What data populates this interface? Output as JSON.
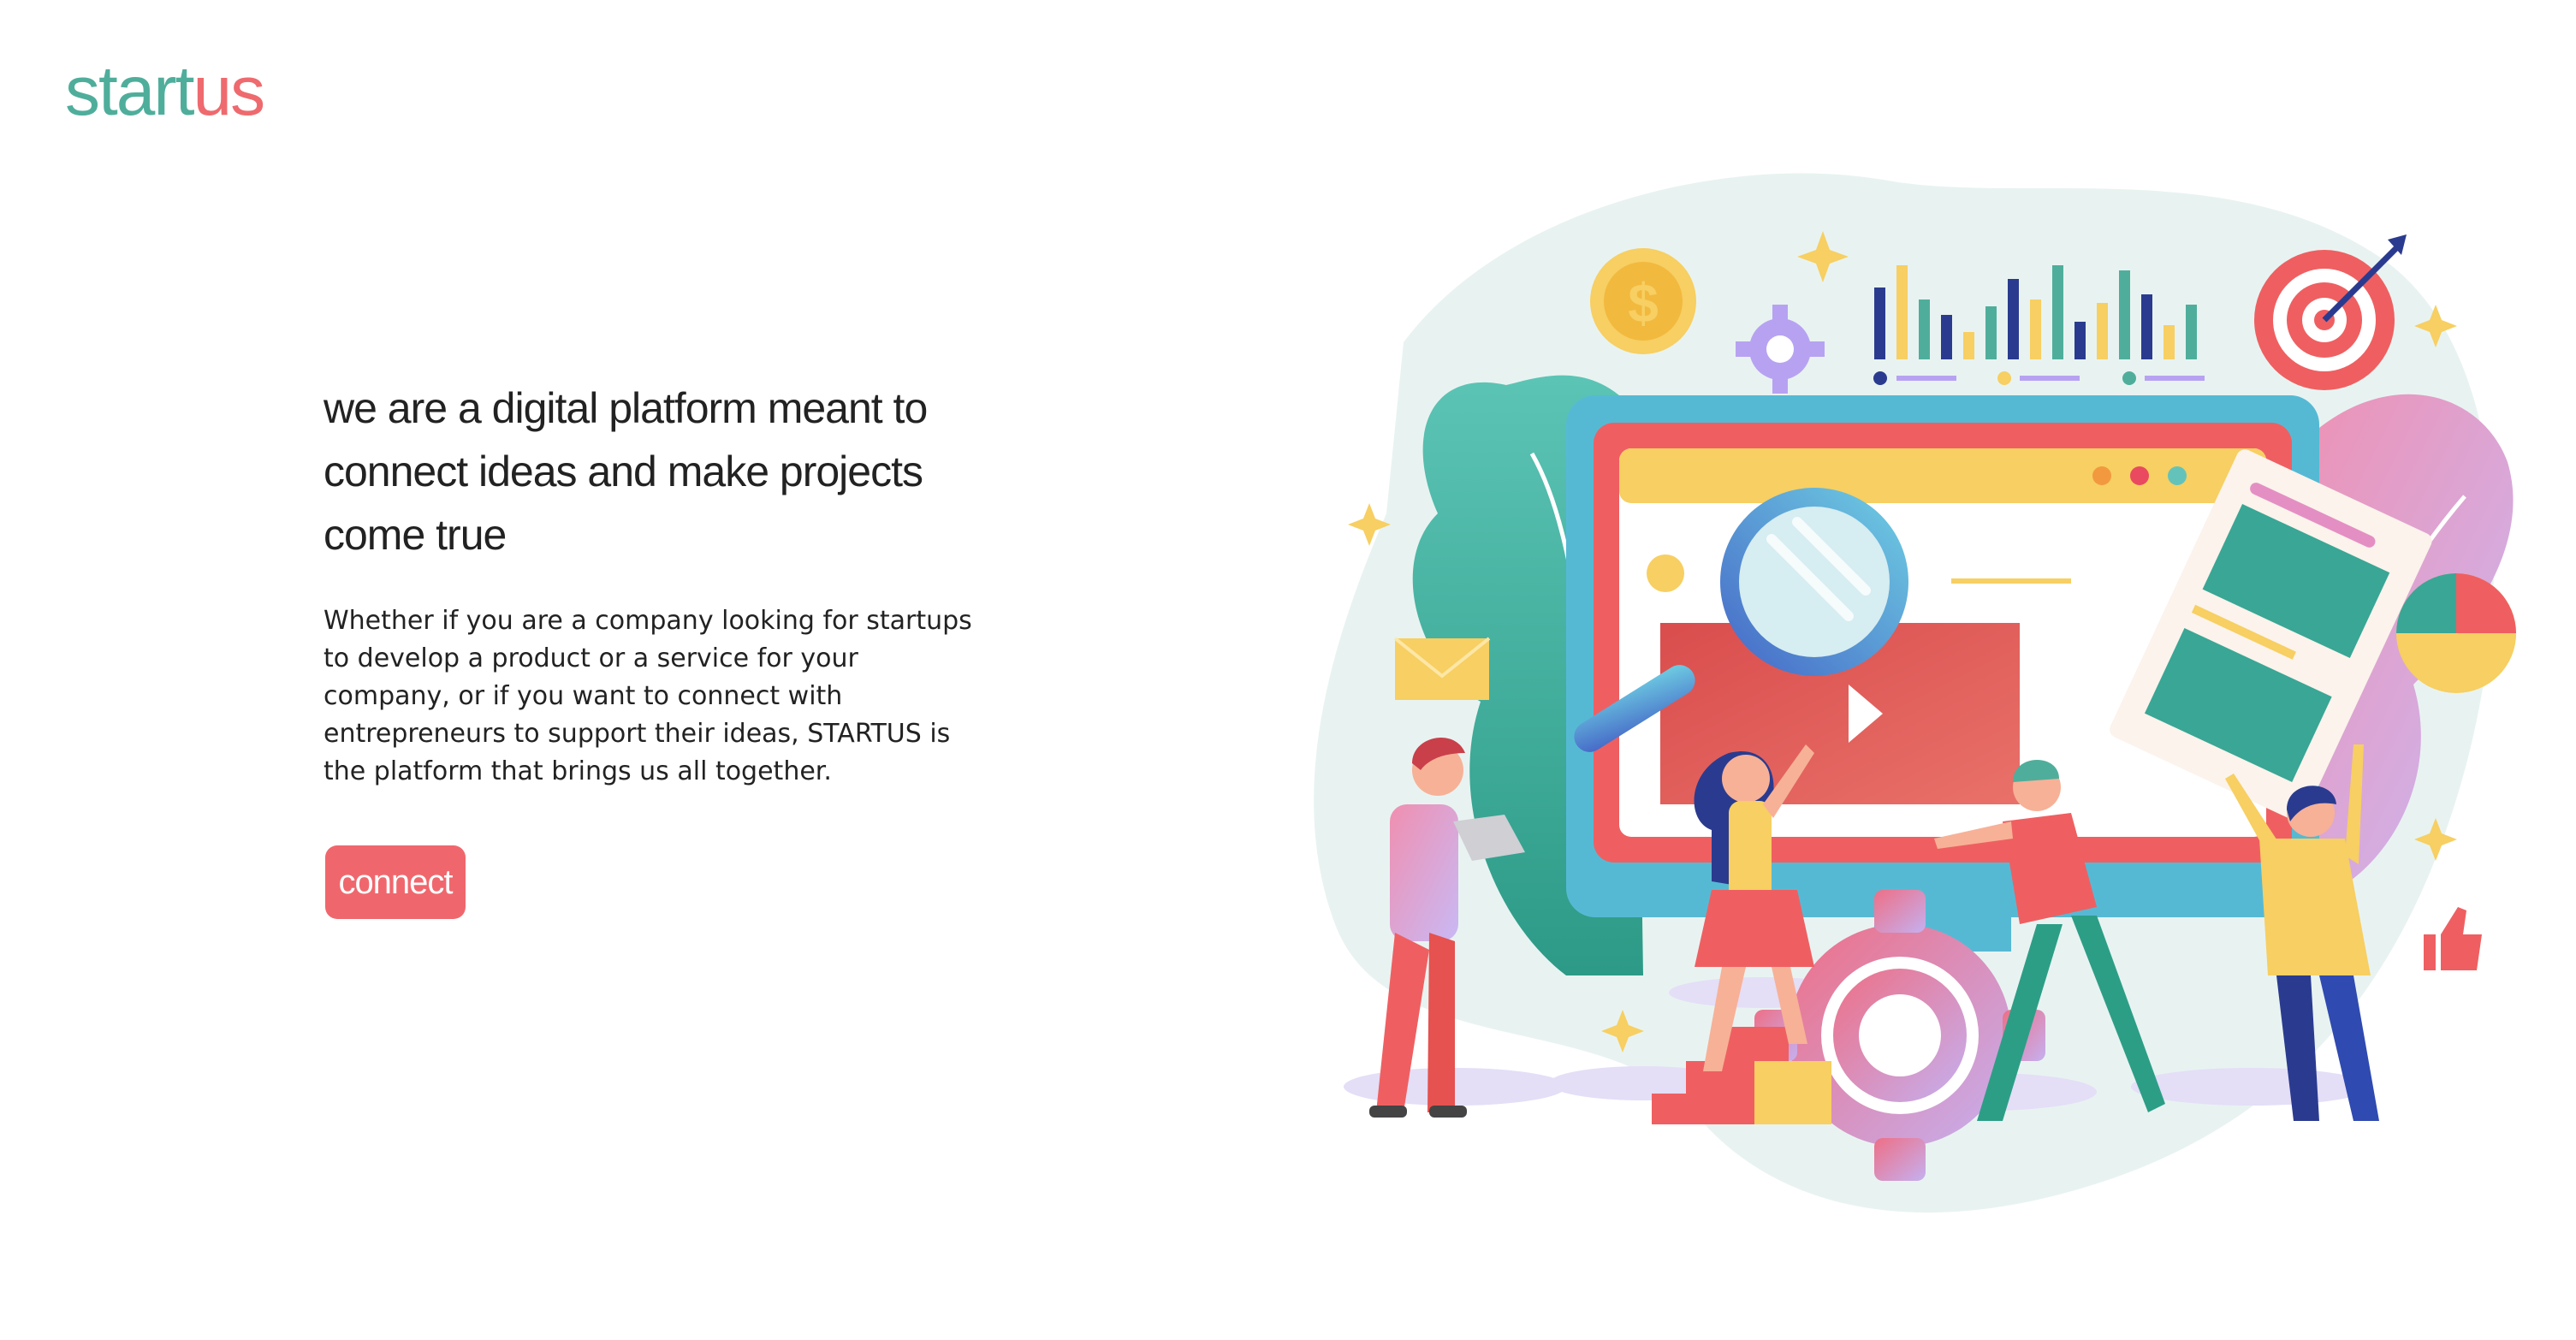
{
  "logo": {
    "part_a": "start",
    "part_b": "us"
  },
  "hero": {
    "heading": "we are a digital platform meant to connect ideas and make projects come true",
    "body": "Whether if you are a company looking for startups to develop a product or a service for your company, or if you want to connect with entrepreneurs to support their ideas, STARTUS is the platform that brings us all together.",
    "cta_label": "connect"
  },
  "illustration": {
    "coin_symbol": "$",
    "icons": [
      "coin-icon",
      "gear-icon",
      "bar-chart-icon",
      "target-icon",
      "envelope-icon",
      "pie-chart-icon",
      "thumbs-up-icon",
      "play-icon",
      "magnifier-icon",
      "sparkle-icon"
    ]
  },
  "colors": {
    "teal": "#4fae9b",
    "coral": "#ef676d",
    "yellow": "#f7cf62",
    "navy": "#2a3b8f",
    "lavender": "#c7b6f2",
    "sky": "#56b9d4"
  }
}
